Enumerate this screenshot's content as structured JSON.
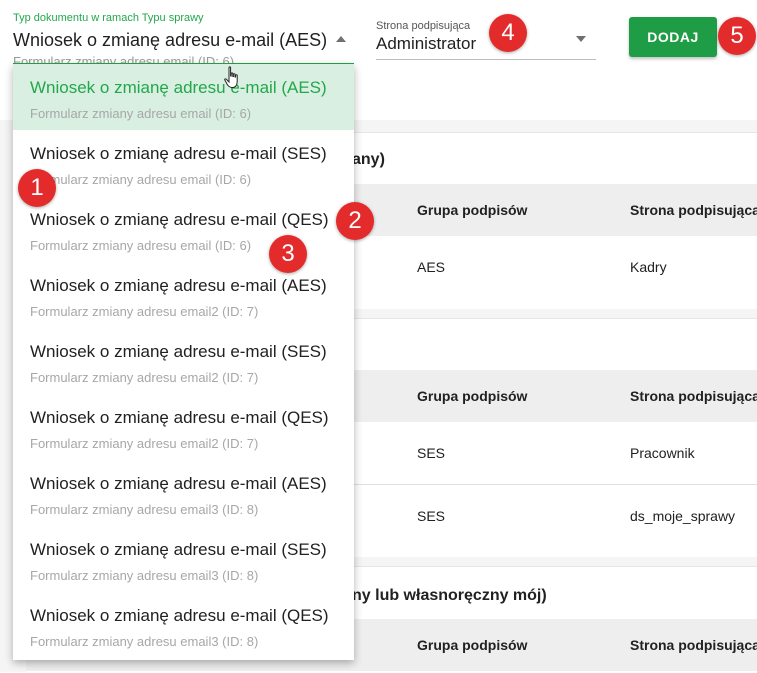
{
  "form": {
    "doc_type_label": "Typ dokumentu w ramach Typu sprawy",
    "doc_type_value": "Wniosek o zmianę adresu e-mail (AES)",
    "doc_type_sub": "Formularz zmiany adresu email (ID: 6)",
    "signer_label": "Strona podpisująca",
    "signer_value": "Administrator",
    "add_button": "DODAJ"
  },
  "markers": [
    "1",
    "2",
    "3",
    "4",
    "5"
  ],
  "dropdown": {
    "options": [
      {
        "title": "Wniosek o zmianę adresu e-mail (AES)",
        "sub": "Formularz zmiany adresu email (ID: 6)"
      },
      {
        "title": "Wniosek o zmianę adresu e-mail (SES)",
        "sub": "Formularz zmiany adresu email (ID: 6)"
      },
      {
        "title": "Wniosek o zmianę adresu e-mail (QES)",
        "sub": "Formularz zmiany adresu email (ID: 6)"
      },
      {
        "title": "Wniosek o zmianę adresu e-mail (AES)",
        "sub": "Formularz zmiany adresu email2 (ID: 7)"
      },
      {
        "title": "Wniosek o zmianę adresu e-mail (SES)",
        "sub": "Formularz zmiany adresu email2 (ID: 7)"
      },
      {
        "title": "Wniosek o zmianę adresu e-mail (QES)",
        "sub": "Formularz zmiany adresu email2 (ID: 7)"
      },
      {
        "title": "Wniosek o zmianę adresu e-mail (AES)",
        "sub": "Formularz zmiany adresu email3 (ID: 8)"
      },
      {
        "title": "Wniosek o zmianę adresu e-mail (SES)",
        "sub": "Formularz zmiany adresu email3 (ID: 8)"
      },
      {
        "title": "Wniosek o zmianę adresu e-mail (QES)",
        "sub": "Formularz zmiany adresu email3 (ID: 8)"
      }
    ]
  },
  "background": {
    "card1": {
      "title_fragment": "any)",
      "col_group": "Grupa podpisów",
      "col_signer": "Strona podpisująca",
      "row1_group": "AES",
      "row1_signer": "Kadry"
    },
    "card2": {
      "col_group": "Grupa podpisów",
      "col_signer": "Strona podpisująca",
      "row1_group": "SES",
      "row1_signer": "Pracownik",
      "row2_group": "SES",
      "row2_signer": "ds_moje_sprawy"
    },
    "card3": {
      "title_fragment": "ny lub własnoręczny mój)",
      "col_group": "Grupa podpisów",
      "col_signer": "Strona podpisująca"
    }
  }
}
